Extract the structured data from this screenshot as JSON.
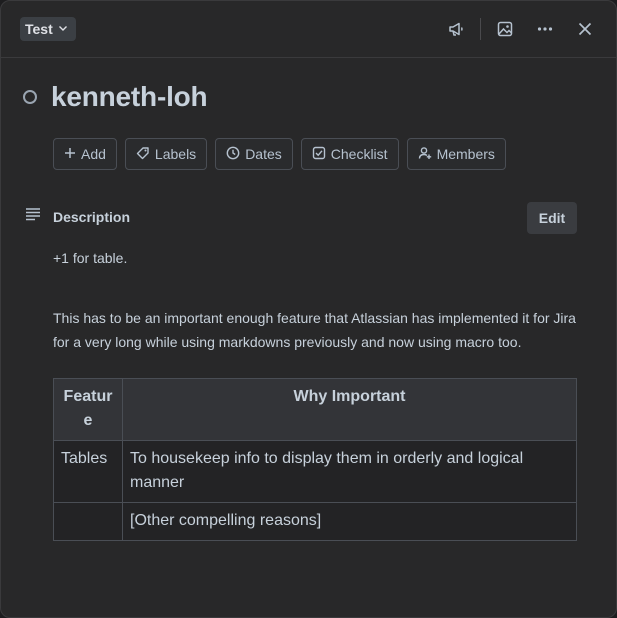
{
  "header": {
    "list_name": "Test",
    "icons": [
      "megaphone-icon",
      "image-icon",
      "more-icon",
      "close-icon"
    ]
  },
  "card": {
    "title": "kenneth-loh"
  },
  "actions": [
    {
      "label": "Add",
      "icon": "plus-icon"
    },
    {
      "label": "Labels",
      "icon": "tag-icon"
    },
    {
      "label": "Dates",
      "icon": "clock-icon"
    },
    {
      "label": "Checklist",
      "icon": "checkbox-icon"
    },
    {
      "label": "Members",
      "icon": "add-user-icon"
    }
  ],
  "description": {
    "heading": "Description",
    "edit_label": "Edit",
    "paragraph1": "+1 for table.",
    "paragraph2": "This has to be an important enough feature that Atlassian has implemented it for Jira for a very long while using markdowns previously and now using macro too.",
    "table": {
      "headers": [
        "Featur e",
        "Why Important"
      ],
      "rows": [
        [
          "Tables",
          "To housekeep info to display them in orderly and logical manner"
        ],
        [
          "",
          "[Other compelling reasons]"
        ]
      ]
    }
  },
  "colors": {
    "panel_bg": "#282829",
    "text": "#c7d1db",
    "border": "#4a4e55"
  }
}
